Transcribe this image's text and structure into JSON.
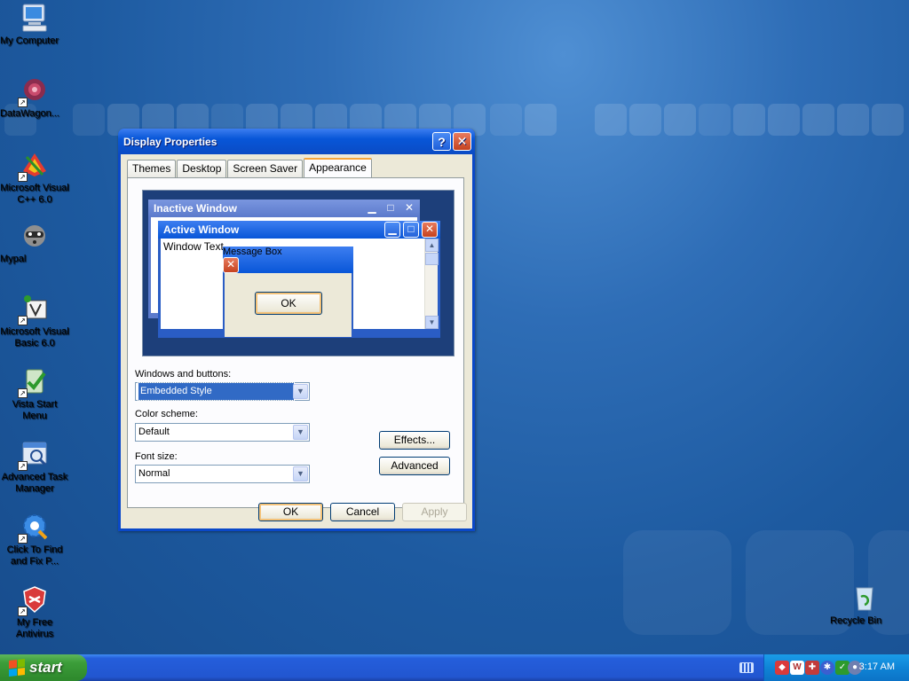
{
  "desktop": {
    "icons": [
      {
        "label": "My Computer"
      },
      {
        "label": "DataWagon..."
      },
      {
        "label": "Microsoft Visual C++ 6.0"
      },
      {
        "label": "Mypal"
      },
      {
        "label": "Microsoft Visual Basic 6.0"
      },
      {
        "label": "Vista Start Menu"
      },
      {
        "label": "Advanced Task Manager"
      },
      {
        "label": "Click To Find and Fix P..."
      },
      {
        "label": "My Free Antivirus"
      },
      {
        "label": "Recycle Bin"
      }
    ]
  },
  "dialog": {
    "title": "Display Properties",
    "help_glyph": "?",
    "close_glyph": "✕",
    "tabs": [
      "Themes",
      "Desktop",
      "Screen Saver",
      "Appearance"
    ],
    "active_tab": "Appearance",
    "preview": {
      "inactive_title": "Inactive Window",
      "active_title": "Active Window",
      "window_text": "Window Text",
      "message_title": "Message Box",
      "message_ok": "OK"
    },
    "windows_buttons_label": "Windows and buttons:",
    "windows_buttons_value": "Embedded Style",
    "color_scheme_label": "Color scheme:",
    "color_scheme_value": "Default",
    "font_size_label": "Font size:",
    "font_size_value": "Normal",
    "effects_button": "Effects...",
    "advanced_button": "Advanced",
    "ok_button": "OK",
    "cancel_button": "Cancel",
    "apply_button": "Apply"
  },
  "taskbar": {
    "start_label": "start",
    "clock": "3:17 AM"
  },
  "colors": {
    "title_blue": "#0856d8",
    "dialog_face": "#ece9d8",
    "start_green": "#3c9e3a",
    "tray_blue": "#0f84d6"
  }
}
